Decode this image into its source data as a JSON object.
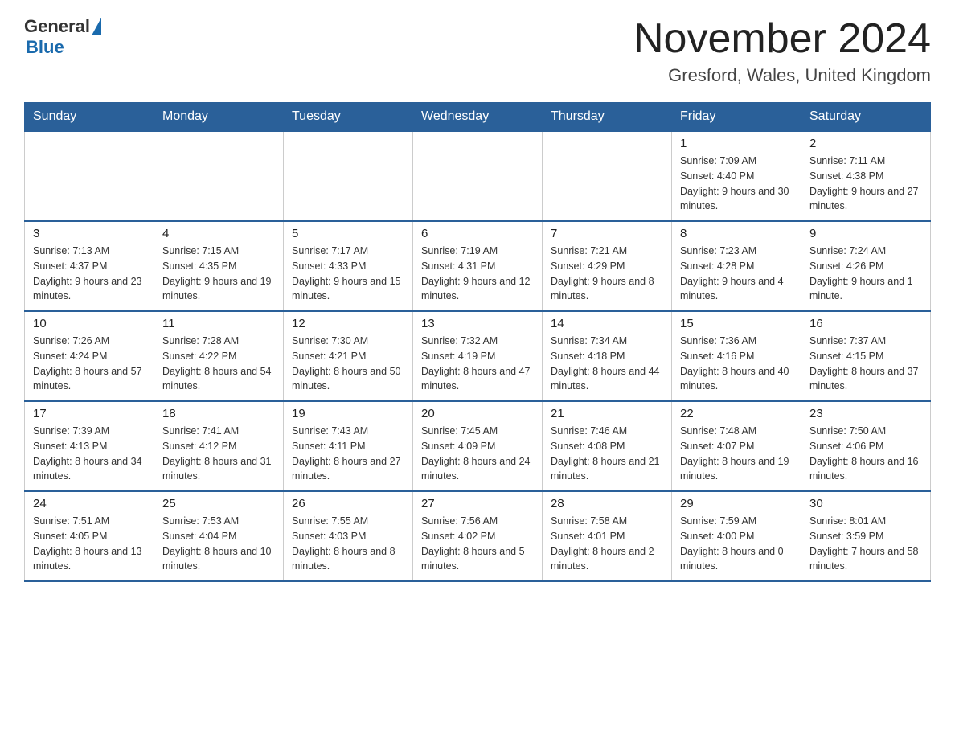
{
  "header": {
    "logo": {
      "general": "General",
      "blue": "Blue"
    },
    "title": "November 2024",
    "location": "Gresford, Wales, United Kingdom"
  },
  "weekdays": [
    "Sunday",
    "Monday",
    "Tuesday",
    "Wednesday",
    "Thursday",
    "Friday",
    "Saturday"
  ],
  "weeks": [
    [
      null,
      null,
      null,
      null,
      null,
      {
        "day": "1",
        "sunrise": "Sunrise: 7:09 AM",
        "sunset": "Sunset: 4:40 PM",
        "daylight": "Daylight: 9 hours and 30 minutes."
      },
      {
        "day": "2",
        "sunrise": "Sunrise: 7:11 AM",
        "sunset": "Sunset: 4:38 PM",
        "daylight": "Daylight: 9 hours and 27 minutes."
      }
    ],
    [
      {
        "day": "3",
        "sunrise": "Sunrise: 7:13 AM",
        "sunset": "Sunset: 4:37 PM",
        "daylight": "Daylight: 9 hours and 23 minutes."
      },
      {
        "day": "4",
        "sunrise": "Sunrise: 7:15 AM",
        "sunset": "Sunset: 4:35 PM",
        "daylight": "Daylight: 9 hours and 19 minutes."
      },
      {
        "day": "5",
        "sunrise": "Sunrise: 7:17 AM",
        "sunset": "Sunset: 4:33 PM",
        "daylight": "Daylight: 9 hours and 15 minutes."
      },
      {
        "day": "6",
        "sunrise": "Sunrise: 7:19 AM",
        "sunset": "Sunset: 4:31 PM",
        "daylight": "Daylight: 9 hours and 12 minutes."
      },
      {
        "day": "7",
        "sunrise": "Sunrise: 7:21 AM",
        "sunset": "Sunset: 4:29 PM",
        "daylight": "Daylight: 9 hours and 8 minutes."
      },
      {
        "day": "8",
        "sunrise": "Sunrise: 7:23 AM",
        "sunset": "Sunset: 4:28 PM",
        "daylight": "Daylight: 9 hours and 4 minutes."
      },
      {
        "day": "9",
        "sunrise": "Sunrise: 7:24 AM",
        "sunset": "Sunset: 4:26 PM",
        "daylight": "Daylight: 9 hours and 1 minute."
      }
    ],
    [
      {
        "day": "10",
        "sunrise": "Sunrise: 7:26 AM",
        "sunset": "Sunset: 4:24 PM",
        "daylight": "Daylight: 8 hours and 57 minutes."
      },
      {
        "day": "11",
        "sunrise": "Sunrise: 7:28 AM",
        "sunset": "Sunset: 4:22 PM",
        "daylight": "Daylight: 8 hours and 54 minutes."
      },
      {
        "day": "12",
        "sunrise": "Sunrise: 7:30 AM",
        "sunset": "Sunset: 4:21 PM",
        "daylight": "Daylight: 8 hours and 50 minutes."
      },
      {
        "day": "13",
        "sunrise": "Sunrise: 7:32 AM",
        "sunset": "Sunset: 4:19 PM",
        "daylight": "Daylight: 8 hours and 47 minutes."
      },
      {
        "day": "14",
        "sunrise": "Sunrise: 7:34 AM",
        "sunset": "Sunset: 4:18 PM",
        "daylight": "Daylight: 8 hours and 44 minutes."
      },
      {
        "day": "15",
        "sunrise": "Sunrise: 7:36 AM",
        "sunset": "Sunset: 4:16 PM",
        "daylight": "Daylight: 8 hours and 40 minutes."
      },
      {
        "day": "16",
        "sunrise": "Sunrise: 7:37 AM",
        "sunset": "Sunset: 4:15 PM",
        "daylight": "Daylight: 8 hours and 37 minutes."
      }
    ],
    [
      {
        "day": "17",
        "sunrise": "Sunrise: 7:39 AM",
        "sunset": "Sunset: 4:13 PM",
        "daylight": "Daylight: 8 hours and 34 minutes."
      },
      {
        "day": "18",
        "sunrise": "Sunrise: 7:41 AM",
        "sunset": "Sunset: 4:12 PM",
        "daylight": "Daylight: 8 hours and 31 minutes."
      },
      {
        "day": "19",
        "sunrise": "Sunrise: 7:43 AM",
        "sunset": "Sunset: 4:11 PM",
        "daylight": "Daylight: 8 hours and 27 minutes."
      },
      {
        "day": "20",
        "sunrise": "Sunrise: 7:45 AM",
        "sunset": "Sunset: 4:09 PM",
        "daylight": "Daylight: 8 hours and 24 minutes."
      },
      {
        "day": "21",
        "sunrise": "Sunrise: 7:46 AM",
        "sunset": "Sunset: 4:08 PM",
        "daylight": "Daylight: 8 hours and 21 minutes."
      },
      {
        "day": "22",
        "sunrise": "Sunrise: 7:48 AM",
        "sunset": "Sunset: 4:07 PM",
        "daylight": "Daylight: 8 hours and 19 minutes."
      },
      {
        "day": "23",
        "sunrise": "Sunrise: 7:50 AM",
        "sunset": "Sunset: 4:06 PM",
        "daylight": "Daylight: 8 hours and 16 minutes."
      }
    ],
    [
      {
        "day": "24",
        "sunrise": "Sunrise: 7:51 AM",
        "sunset": "Sunset: 4:05 PM",
        "daylight": "Daylight: 8 hours and 13 minutes."
      },
      {
        "day": "25",
        "sunrise": "Sunrise: 7:53 AM",
        "sunset": "Sunset: 4:04 PM",
        "daylight": "Daylight: 8 hours and 10 minutes."
      },
      {
        "day": "26",
        "sunrise": "Sunrise: 7:55 AM",
        "sunset": "Sunset: 4:03 PM",
        "daylight": "Daylight: 8 hours and 8 minutes."
      },
      {
        "day": "27",
        "sunrise": "Sunrise: 7:56 AM",
        "sunset": "Sunset: 4:02 PM",
        "daylight": "Daylight: 8 hours and 5 minutes."
      },
      {
        "day": "28",
        "sunrise": "Sunrise: 7:58 AM",
        "sunset": "Sunset: 4:01 PM",
        "daylight": "Daylight: 8 hours and 2 minutes."
      },
      {
        "day": "29",
        "sunrise": "Sunrise: 7:59 AM",
        "sunset": "Sunset: 4:00 PM",
        "daylight": "Daylight: 8 hours and 0 minutes."
      },
      {
        "day": "30",
        "sunrise": "Sunrise: 8:01 AM",
        "sunset": "Sunset: 3:59 PM",
        "daylight": "Daylight: 7 hours and 58 minutes."
      }
    ]
  ]
}
